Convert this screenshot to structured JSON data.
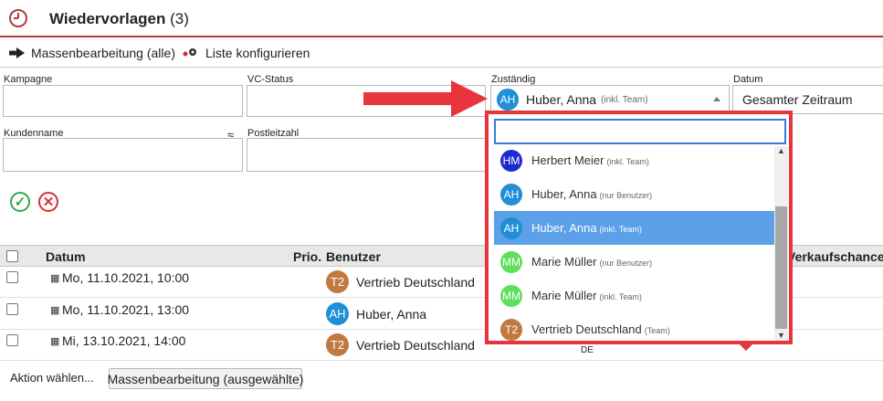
{
  "header": {
    "title": "Wiedervorlagen",
    "count": "(3)"
  },
  "toolbar": {
    "mass_edit_label": "Massenbearbeitung (alle)",
    "configure_label": "Liste konfigurieren"
  },
  "filters": {
    "kampagne_label": "Kampagne",
    "vcstatus_label": "VC-Status",
    "zustaendig_label": "Zuständig",
    "datum_label": "Datum",
    "kundenname_label": "Kundenname",
    "kundenname_hint": "≈",
    "plz_label": "Postleitzahl",
    "zustaendig_selected": {
      "initials": "AH",
      "name": "Huber, Anna",
      "sub": "(inkl. Team)"
    },
    "datum_value": "Gesamter Zeitraum"
  },
  "dropdown": {
    "search_value": "",
    "items": [
      {
        "initials": "HM",
        "name": "Herbert Meier",
        "sub": "(inkl. Team)",
        "color": "#1f2bd0"
      },
      {
        "initials": "AH",
        "name": "Huber, Anna",
        "sub": "(nur Benutzer)",
        "color": "#1e8fd8"
      },
      {
        "initials": "AH",
        "name": "Huber, Anna",
        "sub": "(inkl. Team)",
        "color": "#1e8fd8"
      },
      {
        "initials": "MM",
        "name": "Marie Müller",
        "sub": "(nur Benutzer)",
        "color": "#5ee05a"
      },
      {
        "initials": "MM",
        "name": "Marie Müller",
        "sub": "(inkl. Team)",
        "color": "#5ee05a"
      },
      {
        "initials": "T2",
        "name": "Vertrieb Deutschland",
        "sub": "(Team)",
        "color": "#c07a40"
      }
    ]
  },
  "table": {
    "headers": {
      "datum": "Datum",
      "prio": "Prio.",
      "benutzer": "Benutzer",
      "verkauf": "Verkaufschance"
    },
    "rows": [
      {
        "date": "Mo, 11.10.2021, 10:00",
        "user": "Vertrieb Deutschland",
        "initials": "T2"
      },
      {
        "date": "Mo, 11.10.2021, 13:00",
        "user": "Huber, Anna",
        "initials": "AH"
      },
      {
        "date": "Mi, 13.10.2021, 14:00",
        "user": "Vertrieb Deutschland",
        "initials": "T2"
      }
    ],
    "country_fragment": "DE"
  },
  "footer": {
    "action_label": "Aktion wählen...",
    "mass_edit_selected": "Massenbearbeitung (ausgewählte)"
  },
  "colors": {
    "accent_red": "#e8353d",
    "selected_blue": "#5ba0e8",
    "team_orange": "#c07a40",
    "user_blue": "#1e8fd8"
  }
}
